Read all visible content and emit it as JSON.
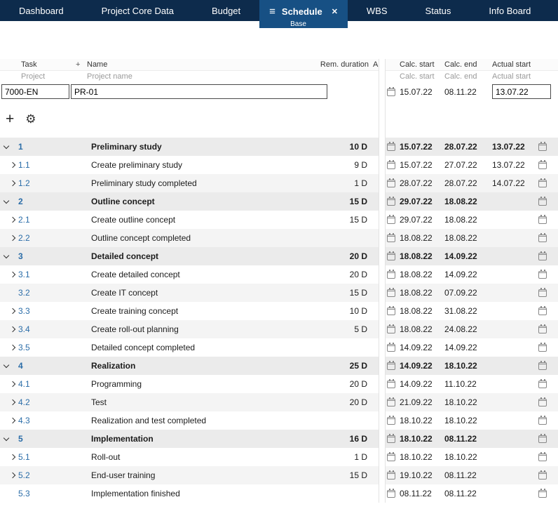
{
  "colors": {
    "navbar_bg": "#0d2b4c",
    "active_tab_bg": "#175084",
    "task_id_color": "#2b6da8",
    "parent_row_bg": "#ebebeb",
    "alt_row_bg": "#f4f4f4",
    "header_text": "#333333",
    "subheader_text": "#9a9a9a"
  },
  "nav": {
    "tabs": [
      {
        "label": "Dashboard"
      },
      {
        "label": "Project Core Data"
      },
      {
        "label": "Budget"
      },
      {
        "label": "Schedule",
        "active": true,
        "sublabel": "Base",
        "menu_icon": "≡",
        "close_icon": "✕"
      },
      {
        "label": "WBS"
      },
      {
        "label": "Status"
      },
      {
        "label": "Info Board"
      }
    ]
  },
  "table": {
    "left_headers": {
      "task": "Task",
      "plus": "+",
      "name": "Name",
      "rem_duration": "Rem. duration",
      "a": "A"
    },
    "left_subheaders": {
      "project": "Project",
      "project_name": "Project name"
    },
    "right_headers": {
      "calc_start": "Calc. start",
      "calc_end": "Calc. end",
      "actual_start": "Actual start"
    },
    "right_subheaders": {
      "calc_start": "Calc. start",
      "calc_end": "Calc. end",
      "actual_start": "Actual start"
    },
    "project_row": {
      "task": "7000-EN",
      "name": "PR-01",
      "calc_start": "15.07.22",
      "calc_end": "08.11.22",
      "actual_start": "13.07.22"
    }
  },
  "toolbar": {
    "plus_icon": "+",
    "gear_icon": "⚙"
  },
  "tasks": [
    {
      "id": "1",
      "name": "Preliminary study",
      "duration": "10 D",
      "calc_start": "15.07.22",
      "calc_end": "28.07.22",
      "actual_start": "13.07.22",
      "level": 0,
      "chevron": "down"
    },
    {
      "id": "1.1",
      "name": "Create preliminary study",
      "duration": "9 D",
      "calc_start": "15.07.22",
      "calc_end": "27.07.22",
      "actual_start": "13.07.22",
      "level": 1,
      "chevron": "right"
    },
    {
      "id": "1.2",
      "name": "Preliminary study completed",
      "duration": "1 D",
      "calc_start": "28.07.22",
      "calc_end": "28.07.22",
      "actual_start": "14.07.22",
      "level": 1,
      "chevron": "right"
    },
    {
      "id": "2",
      "name": "Outline concept",
      "duration": "15 D",
      "calc_start": "29.07.22",
      "calc_end": "18.08.22",
      "actual_start": "",
      "level": 0,
      "chevron": "down"
    },
    {
      "id": "2.1",
      "name": "Create outline concept",
      "duration": "15 D",
      "calc_start": "29.07.22",
      "calc_end": "18.08.22",
      "actual_start": "",
      "level": 1,
      "chevron": "right"
    },
    {
      "id": "2.2",
      "name": "Outline concept completed",
      "duration": "",
      "calc_start": "18.08.22",
      "calc_end": "18.08.22",
      "actual_start": "",
      "level": 1,
      "chevron": "right"
    },
    {
      "id": "3",
      "name": "Detailed concept",
      "duration": "20 D",
      "calc_start": "18.08.22",
      "calc_end": "14.09.22",
      "actual_start": "",
      "level": 0,
      "chevron": "down"
    },
    {
      "id": "3.1",
      "name": "Create detailed concept",
      "duration": "20 D",
      "calc_start": "18.08.22",
      "calc_end": "14.09.22",
      "actual_start": "",
      "level": 1,
      "chevron": "right"
    },
    {
      "id": "3.2",
      "name": "Create IT concept",
      "duration": "15 D",
      "calc_start": "18.08.22",
      "calc_end": "07.09.22",
      "actual_start": "",
      "level": 1,
      "chevron": "none"
    },
    {
      "id": "3.3",
      "name": "Create training concept",
      "duration": "10 D",
      "calc_start": "18.08.22",
      "calc_end": "31.08.22",
      "actual_start": "",
      "level": 1,
      "chevron": "right"
    },
    {
      "id": "3.4",
      "name": "Create roll-out planning",
      "duration": "5 D",
      "calc_start": "18.08.22",
      "calc_end": "24.08.22",
      "actual_start": "",
      "level": 1,
      "chevron": "right"
    },
    {
      "id": "3.5",
      "name": "Detailed concept completed",
      "duration": "",
      "calc_start": "14.09.22",
      "calc_end": "14.09.22",
      "actual_start": "",
      "level": 1,
      "chevron": "right"
    },
    {
      "id": "4",
      "name": "Realization",
      "duration": "25 D",
      "calc_start": "14.09.22",
      "calc_end": "18.10.22",
      "actual_start": "",
      "level": 0,
      "chevron": "down"
    },
    {
      "id": "4.1",
      "name": "Programming",
      "duration": "20 D",
      "calc_start": "14.09.22",
      "calc_end": "11.10.22",
      "actual_start": "",
      "level": 1,
      "chevron": "right"
    },
    {
      "id": "4.2",
      "name": "Test",
      "duration": "20 D",
      "calc_start": "21.09.22",
      "calc_end": "18.10.22",
      "actual_start": "",
      "level": 1,
      "chevron": "right"
    },
    {
      "id": "4.3",
      "name": "Realization and test completed",
      "duration": "",
      "calc_start": "18.10.22",
      "calc_end": "18.10.22",
      "actual_start": "",
      "level": 1,
      "chevron": "right"
    },
    {
      "id": "5",
      "name": "Implementation",
      "duration": "16 D",
      "calc_start": "18.10.22",
      "calc_end": "08.11.22",
      "actual_start": "",
      "level": 0,
      "chevron": "down"
    },
    {
      "id": "5.1",
      "name": "Roll-out",
      "duration": "1 D",
      "calc_start": "18.10.22",
      "calc_end": "18.10.22",
      "actual_start": "",
      "level": 1,
      "chevron": "right"
    },
    {
      "id": "5.2",
      "name": "End-user training",
      "duration": "15 D",
      "calc_start": "19.10.22",
      "calc_end": "08.11.22",
      "actual_start": "",
      "level": 1,
      "chevron": "right"
    },
    {
      "id": "5.3",
      "name": "Implementation finished",
      "duration": "",
      "calc_start": "08.11.22",
      "calc_end": "08.11.22",
      "actual_start": "",
      "level": 1,
      "chevron": "none"
    }
  ]
}
